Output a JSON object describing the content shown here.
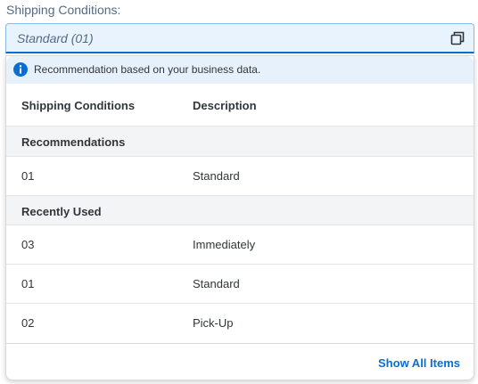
{
  "field": {
    "label": "Shipping Conditions:",
    "value": "Standard (01)",
    "value_help_icon": "value-help-icon"
  },
  "popover": {
    "info_text": "Recommendation based on your business data.",
    "info_icon": "info-icon",
    "columns": [
      "Shipping Conditions",
      "Description"
    ],
    "groups": [
      {
        "title": "Recommendations",
        "rows": [
          {
            "code": "01",
            "description": "Standard"
          }
        ]
      },
      {
        "title": "Recently Used",
        "rows": [
          {
            "code": "03",
            "description": "Immediately"
          },
          {
            "code": "01",
            "description": "Standard"
          },
          {
            "code": "02",
            "description": "Pick-Up"
          }
        ]
      }
    ],
    "show_all_label": "Show All Items"
  },
  "colors": {
    "accent": "#0a6ed1",
    "info_strip": "#e6f1fc",
    "group_bg": "#f3f4f6"
  }
}
